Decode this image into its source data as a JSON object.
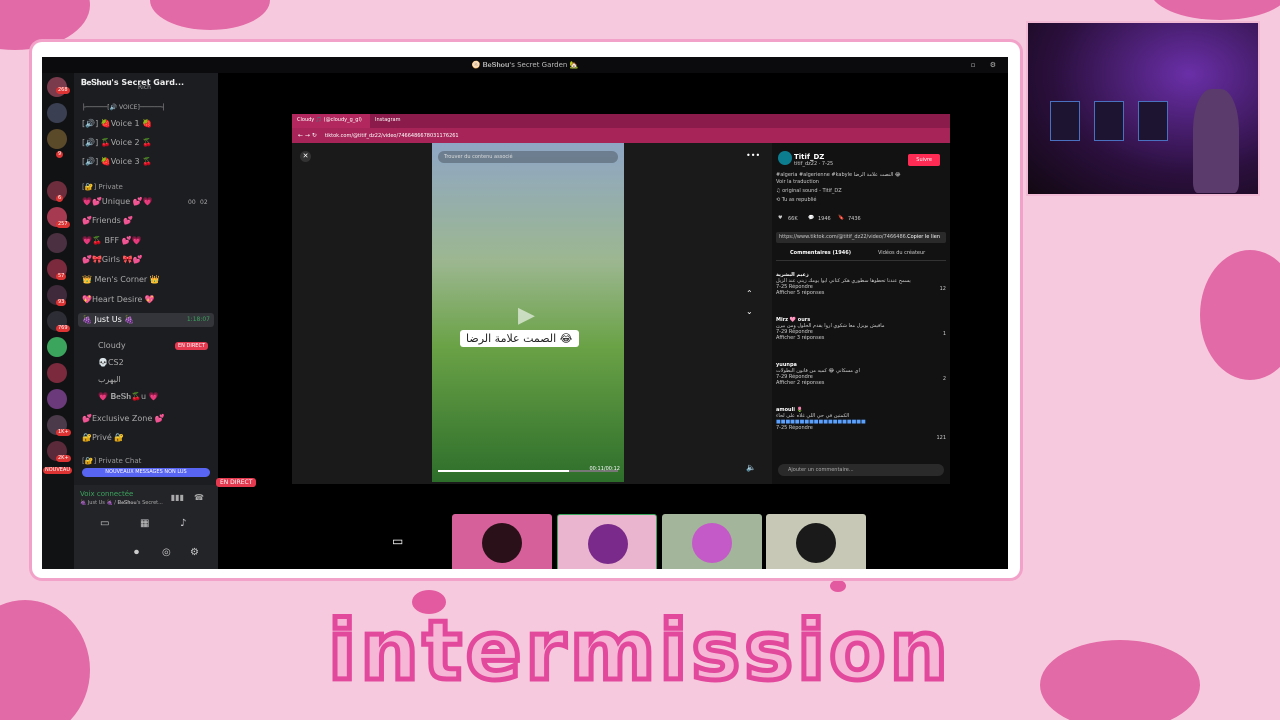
{
  "window": {
    "title": "🫓 𝐁𝐞𝐒𝐡𝐨𝐮's Secret Garden 🏡"
  },
  "servers": {
    "badges": [
      "268",
      "9",
      "8",
      "6",
      "257",
      "57",
      "93",
      "769",
      "1K+",
      "2K+",
      "NOUVEAU"
    ]
  },
  "sidebar": {
    "server_name": "𝐁𝐞𝐒𝐡𝐨𝐮's Secret Gard...",
    "partial_item": "Rich",
    "voice_category": "├──────[🔊 VOICE]──────┤",
    "voice_channels": [
      "[🔊] 🍓Voice 1 🍓",
      "[🔊] 🍒Voice 2 🍒",
      "[🔊] 🍓Voice 3 🍒"
    ],
    "private_category": "[🔐] Private",
    "private_channels": [
      "💗💕Unique 💕💗",
      "💕Friends 💕",
      "💗🍒 BFF 💕💗",
      "💕🎀Girls 🎀💕",
      "👑 Men's Corner 👑",
      "💖Heart Desire 💖"
    ],
    "unique_counts": [
      "00",
      "02"
    ],
    "selected_channel": "🍇 Just Us 🍇",
    "selected_timer": "1:18:07",
    "members": [
      {
        "name": "Cloudy",
        "badge": "EN DIRECT"
      },
      {
        "name": "💀CS2",
        "badge": ""
      },
      {
        "name": "اليهرب",
        "badge": ""
      },
      {
        "name": "💗 𝐁𝐞𝐒𝐡🍒u 💗",
        "badge": ""
      }
    ],
    "after_channels": [
      "💕Exclusive Zone 💕",
      "🔐Privé 🔐"
    ],
    "private_chat_category": "[🔐] Private Chat",
    "unread_banner": "NOUVEAUX MESSAGES NON LUS",
    "voice_status": "Voix connectée",
    "voice_sub": "🍇 Just Us 🍇 / 𝐁𝐞𝐒𝐡𝐨𝐮's Secret..."
  },
  "browser": {
    "tabs": [
      "Cloudy 🎵 (@cloudy_g_gl)",
      "Instagram"
    ],
    "url": "tiktok.com/@titif_dz22/video/7466486678031176261",
    "search_placeholder": "Trouver du contenu associé",
    "caption": "الصمت علامة الرضا 😂",
    "time": "00:11/00:12",
    "progress": 0.73,
    "author": "Titif_DZ",
    "author_sub": "titif_dz22 · 7-25",
    "follow_label": "Suivre",
    "desc": "#algeria #algerienne #kabyle النصت علامة الرضا 😂",
    "translate": "Voir la traduction",
    "sound": "♫ original sound - Titif_DZ",
    "reposted": "⟲ Tu as republié",
    "stats": [
      "66K",
      "1946",
      "7436"
    ],
    "link": "https://www.tiktok.com/@titif_dz22/video/7466486...",
    "copy_label": "Copier le lien",
    "comments_tab": "Commentaires (1946)",
    "creator_tab": "Vidéos du créateur",
    "comments": [
      {
        "user": "زعيم البشرية",
        "text": "يسمح عندنا تحطوها سطوري هكر كتاني ايوا يومك زيني عند الزيل",
        "meta": "7-25  Répondre",
        "likes": "12",
        "replies": "Afficher 5 réponses"
      },
      {
        "user": "Mirz 🩷 ours",
        "text": "مافيش بويزل معا شكوي اروا يقدم الحلول ومن بيرن",
        "meta": "7-29  Répondre",
        "likes": "1",
        "replies": "Afficher 3 réponses"
      },
      {
        "user": "yuunpa",
        "text": "اي مسكاني 😂 كميه من قانون البطولات",
        "meta": "7-29  Répondre",
        "likes": "2",
        "replies": "Afficher 2 réponses"
      },
      {
        "user": "amouli 🌷",
        "text": "الكمتين في حي اللي غلاه على لحاء",
        "meta": "7-25  Répondre",
        "likes": "121",
        "replies": ""
      }
    ],
    "add_comment": "Ajouter un commentaire..."
  },
  "stream": {
    "live_badge": "EN DIRECT"
  },
  "overlay": {
    "title": "intermission"
  },
  "colors": {
    "accent": "#e2489c",
    "live": "#e53950",
    "tiktok": "#fe2c55",
    "discord_bg": "#1c1d21"
  }
}
